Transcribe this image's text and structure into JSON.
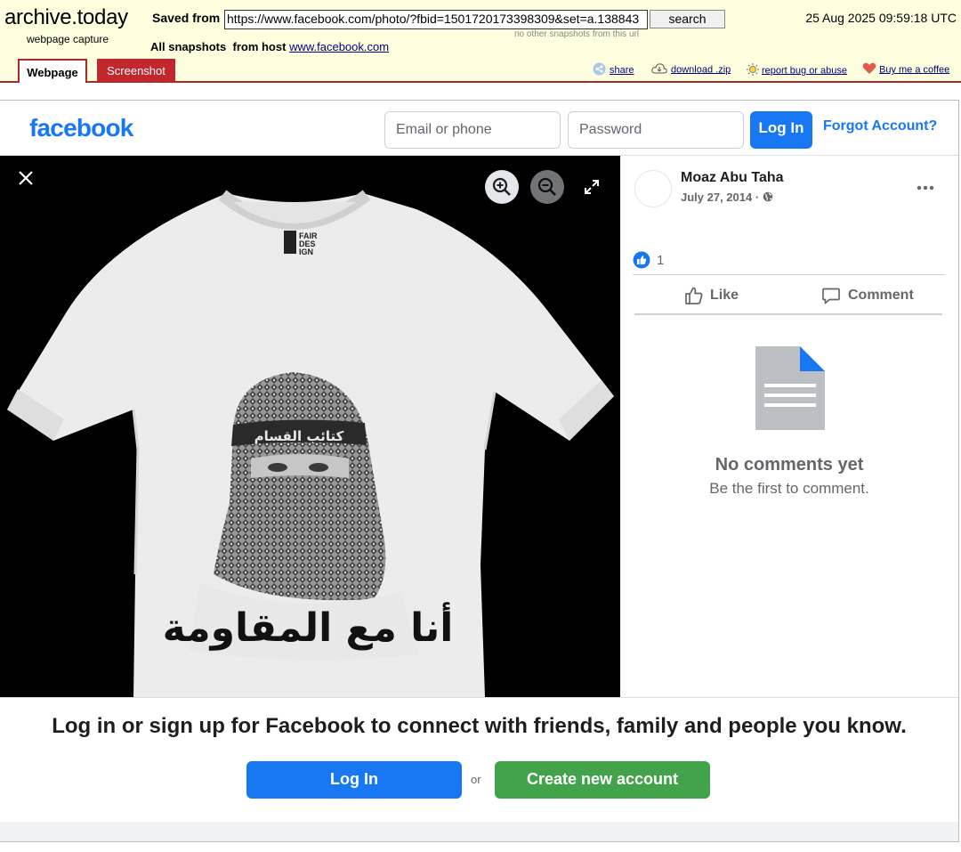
{
  "archive": {
    "logo": "archive.today",
    "subtitle": "webpage capture",
    "saved_from_label": "Saved from",
    "url": "https://www.facebook.com/photo/?fbid=1501720173398309&set=a.138843",
    "search_label": "search",
    "no_other": "no other snapshots from this url",
    "date": "25 Aug 2025 09:59:18 UTC",
    "all_snapshots_label": "All snapshots",
    "from_host_label": "from host",
    "host": "www.facebook.com",
    "tabs": [
      "Webpage",
      "Screenshot"
    ],
    "links": [
      "share",
      "download .zip",
      "report bug or abuse",
      "Buy me a coffee"
    ]
  },
  "facebook": {
    "logo": "facebook",
    "email_placeholder": "Email or phone",
    "password_placeholder": "Password",
    "login_label": "Log In",
    "forgot_label": "Forgot Account?"
  },
  "photo": {
    "brand_tag": [
      "FAIR",
      "DES",
      "IGN"
    ],
    "headband_text": "كتائب القسام",
    "arabic_caption": "أنا مع المقاومة"
  },
  "post": {
    "author": "Moaz Abu Taha",
    "date": "July 27, 2014",
    "date_sep": "·",
    "reaction_count": "1",
    "like_label": "Like",
    "comment_label": "Comment",
    "no_comments_title": "No comments yet",
    "no_comments_sub": "Be the first to comment."
  },
  "cta": {
    "text": "Log in or sign up for Facebook to connect with friends, family and people you know.",
    "login_label": "Log In",
    "or_label": "or",
    "create_label": "Create new account"
  },
  "colors": {
    "archive_bg": "#ffffe0",
    "archive_accent": "#a52a2a",
    "facebook_blue": "#1877f2",
    "create_green": "#42a34a"
  },
  "icons": [
    "share-icon",
    "download-icon",
    "report-icon",
    "heart-icon",
    "close-icon",
    "zoom-in-icon",
    "zoom-out-icon",
    "fullscreen-icon",
    "more-icon",
    "globe-icon",
    "like-reaction-icon",
    "thumbs-up-icon",
    "comment-icon",
    "document-icon"
  ]
}
